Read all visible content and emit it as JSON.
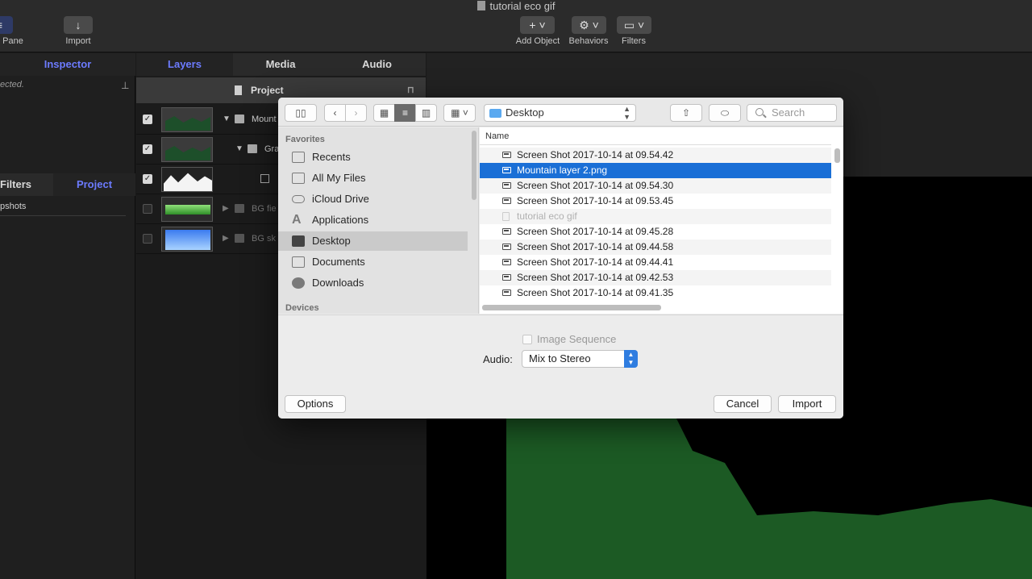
{
  "window": {
    "title": "tutorial eco gif"
  },
  "toolbar": {
    "left_labels": [
      "Pane",
      "Import"
    ],
    "right_labels": [
      "Add Object",
      "Behaviors",
      "Filters"
    ]
  },
  "inspector": {
    "tab": "Inspector",
    "note": "ected.",
    "tabs2": [
      "Filters",
      "Project"
    ],
    "snapshots": "pshots"
  },
  "layers_panel": {
    "tabs": [
      "Layers",
      "Media",
      "Audio"
    ],
    "project": "Project",
    "rows": [
      {
        "name": "Mount",
        "checked": true
      },
      {
        "name": "Gra",
        "checked": true
      },
      {
        "name": "",
        "checked": true
      },
      {
        "name": "BG fie",
        "checked": false
      },
      {
        "name": "BG sk",
        "checked": false
      }
    ]
  },
  "dialog": {
    "location": "Desktop",
    "search_placeholder": "Search",
    "sidebar": {
      "favorites_header": "Favorites",
      "items": [
        "Recents",
        "All My Files",
        "iCloud Drive",
        "Applications",
        "Desktop",
        "Documents",
        "Downloads"
      ],
      "selected": "Desktop",
      "devices_header": "Devices"
    },
    "file_list": {
      "column": "Name",
      "files": [
        {
          "name": "Screen Shot 2017-10-14 at 09.54.42",
          "state": "normal"
        },
        {
          "name": "Mountain layer 2.png",
          "state": "selected"
        },
        {
          "name": "Screen Shot 2017-10-14 at 09.54.30",
          "state": "normal"
        },
        {
          "name": "Screen Shot 2017-10-14 at 09.53.45",
          "state": "normal"
        },
        {
          "name": "tutorial eco gif",
          "state": "disabled"
        },
        {
          "name": "Screen Shot 2017-10-14 at 09.45.28",
          "state": "normal"
        },
        {
          "name": "Screen Shot 2017-10-14 at 09.44.58",
          "state": "normal"
        },
        {
          "name": "Screen Shot 2017-10-14 at 09.44.41",
          "state": "normal"
        },
        {
          "name": "Screen Shot 2017-10-14 at 09.42.53",
          "state": "normal"
        },
        {
          "name": "Screen Shot 2017-10-14 at 09.41.35",
          "state": "normal"
        }
      ]
    },
    "image_sequence_label": "Image Sequence",
    "audio_label": "Audio:",
    "audio_value": "Mix to Stereo",
    "buttons": {
      "options": "Options",
      "cancel": "Cancel",
      "import": "Import"
    }
  },
  "colors": {
    "selection": "#1a6fd6",
    "accent_tab": "#6c7bff",
    "canvas_green": "#1c5a24"
  }
}
